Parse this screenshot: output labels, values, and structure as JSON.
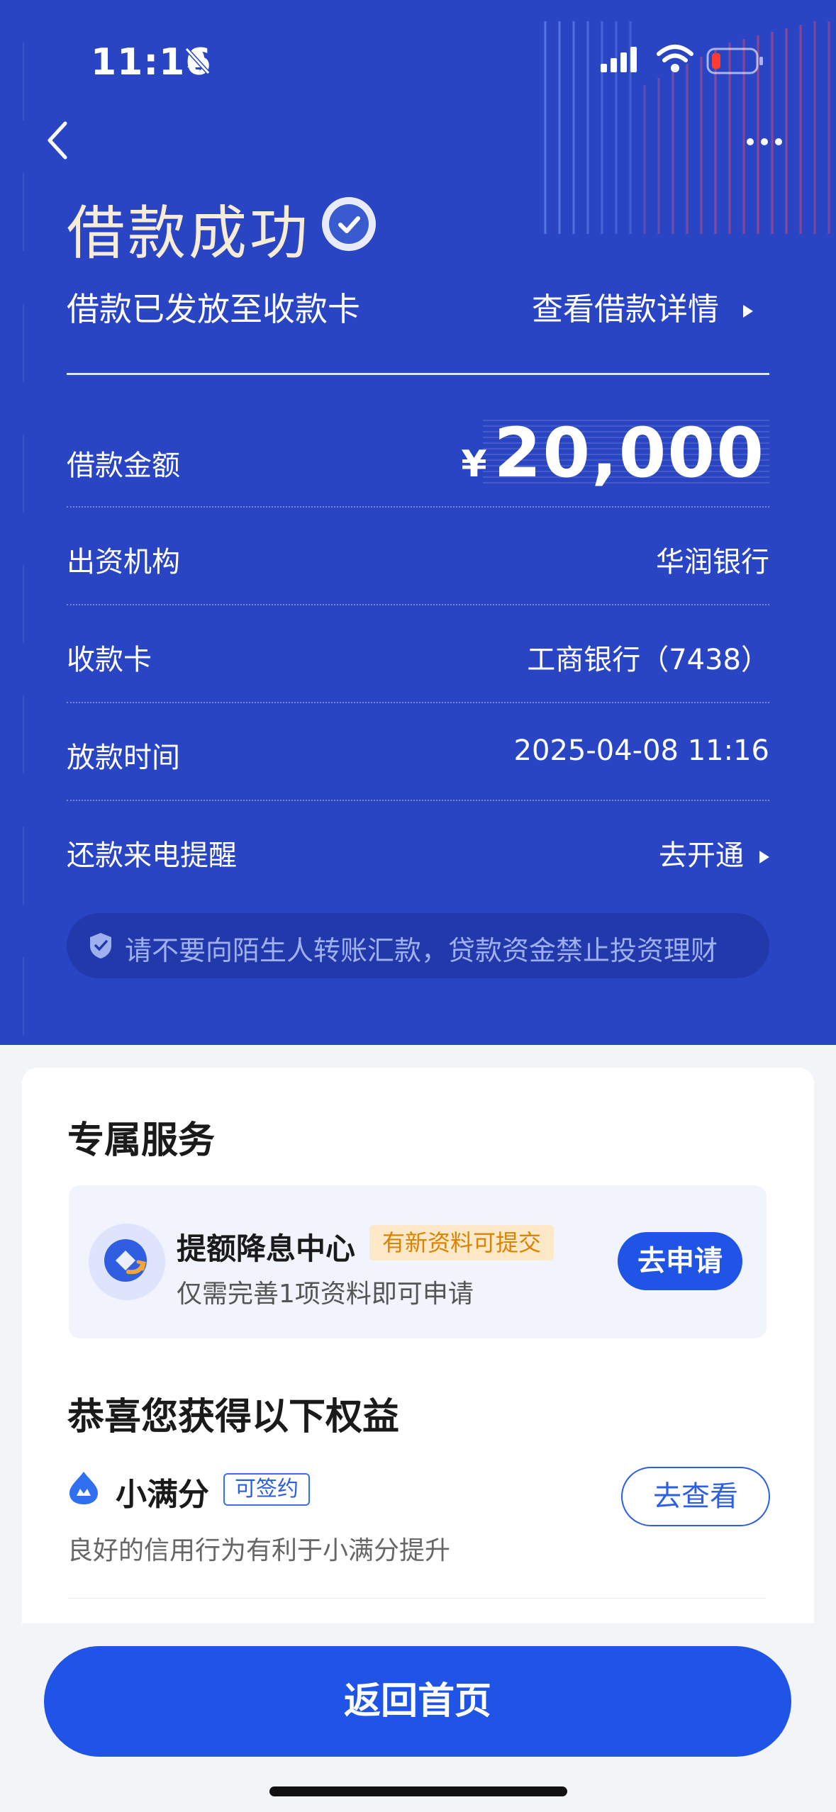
{
  "status_bar": {
    "time": "11:16"
  },
  "header": {
    "title": "借款成功",
    "subtitle": "借款已发放至收款卡",
    "detail_link": "查看借款详情"
  },
  "loan": {
    "amount_label": "借款金额",
    "currency": "¥",
    "amount": "20,000",
    "rows": [
      {
        "label": "出资机构",
        "value": "华润银行"
      },
      {
        "label": "收款卡",
        "value": "工商银行（7438）"
      },
      {
        "label": "放款时间",
        "value": "2025-04-08 11:16"
      },
      {
        "label": "还款来电提醒",
        "value": "去开通"
      }
    ]
  },
  "warning": "请不要向陌生人转账汇款，贷款资金禁止投资理财",
  "services": {
    "title": "专属服务",
    "promo": {
      "title": "提额降息中心",
      "tag": "有新资料可提交",
      "subtitle": "仅需完善1项资料即可申请",
      "button": "去申请"
    }
  },
  "benefits": {
    "title": "恭喜您获得以下权益",
    "items": [
      {
        "name": "小满分",
        "tag": "可签约",
        "desc": "良好的信用行为有利于小满分提升",
        "button": "去查看"
      }
    ]
  },
  "bottom": {
    "home_button": "返回首页"
  },
  "colors": {
    "hero_bg": "#2a45c4",
    "primary_blue": "#1f54e6",
    "title_gold": "#f6ecd8",
    "tag_orange": "#d98300"
  }
}
